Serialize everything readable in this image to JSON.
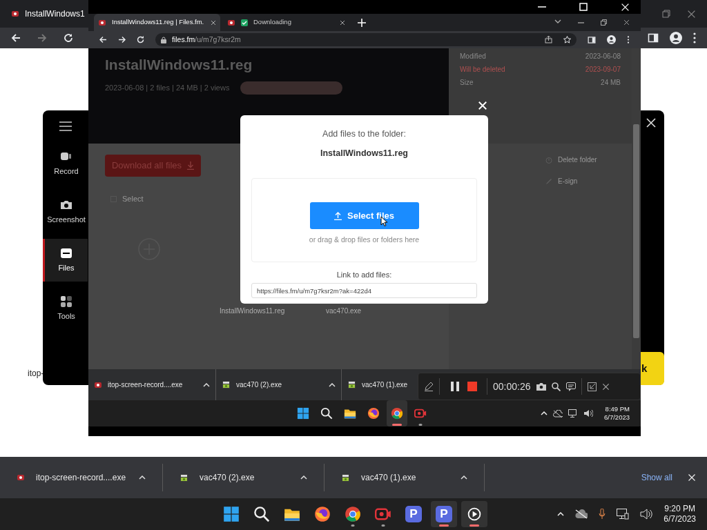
{
  "outer_browser": {
    "tabs": [
      {
        "title": "InstallWindows1",
        "selected": true
      }
    ],
    "side_text": "itop-"
  },
  "recorder_panel": {
    "nav": [
      {
        "label": "Record",
        "kind": "record",
        "selected": false
      },
      {
        "label": "Screenshot",
        "kind": "screenshot",
        "selected": false
      },
      {
        "label": "Files",
        "kind": "files",
        "selected": true
      },
      {
        "label": "Tools",
        "kind": "tools",
        "selected": false
      }
    ],
    "action_button": "k"
  },
  "inner_browser": {
    "tabs": [
      {
        "title": "InstallWindows11.reg | Files.fm.",
        "kind": "site",
        "selected": true
      },
      {
        "title": "Downloading",
        "kind": "download",
        "selected": false
      }
    ],
    "url_host": "files.fm",
    "url_path": "/u/m7g7ksr2m"
  },
  "page": {
    "folder_title": "InstallWindows11.reg",
    "meta": "2023-06-08 | 2 files | 24 MB | 2 views",
    "details": [
      {
        "label": "Modified",
        "value": "2023-06-08",
        "warn": false
      },
      {
        "label": "Will be deleted",
        "value": "2023-09-07",
        "warn": true
      },
      {
        "label": "Size",
        "value": "24 MB",
        "warn": false
      }
    ],
    "actions": [
      {
        "label": "Delete folder",
        "kind": "delete"
      },
      {
        "label": "E-sign",
        "kind": "sign"
      }
    ],
    "download_button": "Download all files",
    "select_label": "Select",
    "files": [
      "InstallWindows11.reg",
      "vac470.exe"
    ]
  },
  "modal": {
    "heading": "Add files to the folder:",
    "folder": "InstallWindows11.reg",
    "button": "Select files",
    "hint": "or drag & drop files or folders here",
    "link_label": "Link to add files:",
    "link": "https://files.fm/u/m7g7ksr2m?ak=422d4"
  },
  "inner_downloads": [
    {
      "name": "itop-screen-record....exe",
      "kind": "itop"
    },
    {
      "name": "vac470 (2).exe",
      "kind": "installer"
    },
    {
      "name": "vac470 (1).exe",
      "kind": "installer"
    }
  ],
  "recording_bar": {
    "time": "00:00:26"
  },
  "inner_taskbar": {
    "apps": [
      {
        "kind": "windows",
        "open": false,
        "active": false
      },
      {
        "kind": "search",
        "open": false,
        "active": false
      },
      {
        "kind": "folder",
        "open": false,
        "active": false
      },
      {
        "kind": "firefox",
        "open": false,
        "active": false
      },
      {
        "kind": "chrome",
        "open": true,
        "active": true
      },
      {
        "kind": "recorder",
        "open": true,
        "active": false
      }
    ],
    "time": "8:49 PM",
    "date": "6/7/2023"
  },
  "outer_downloads": {
    "items": [
      {
        "name": "itop-screen-record....exe",
        "kind": "itop"
      },
      {
        "name": "vac470 (2).exe",
        "kind": "installer"
      },
      {
        "name": "vac470 (1).exe",
        "kind": "installer"
      }
    ],
    "show_all": "Show all"
  },
  "outer_taskbar": {
    "apps": [
      {
        "kind": "windows",
        "open": false,
        "active": false
      },
      {
        "kind": "search",
        "open": false,
        "active": false
      },
      {
        "kind": "folder",
        "open": false,
        "active": false
      },
      {
        "kind": "firefox",
        "open": false,
        "active": false
      },
      {
        "kind": "chrome",
        "open": true,
        "active": false
      },
      {
        "kind": "recorder",
        "open": true,
        "active": false
      },
      {
        "kind": "p-app",
        "label": "P",
        "open": false,
        "active": false
      },
      {
        "kind": "p-app",
        "label": "P",
        "open": true,
        "active": true
      },
      {
        "kind": "player",
        "open": true,
        "active": true
      }
    ],
    "time": "9:20 PM",
    "date": "6/7/2023"
  }
}
